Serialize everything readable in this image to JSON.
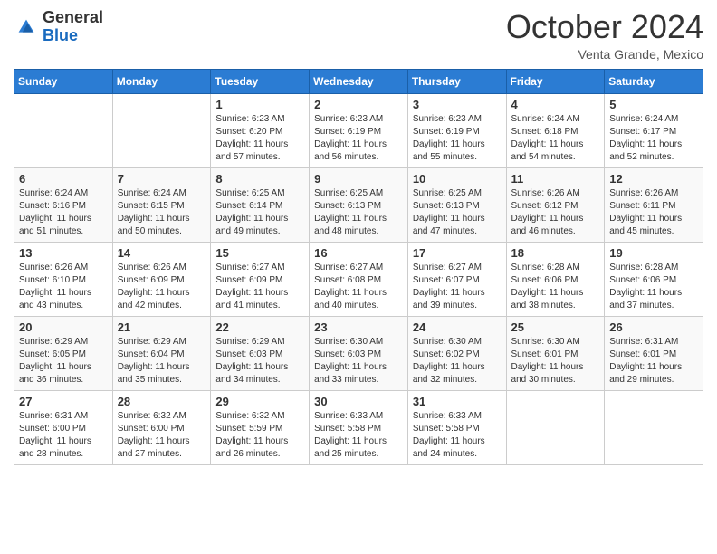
{
  "header": {
    "logo_general": "General",
    "logo_blue": "Blue",
    "month_title": "October 2024",
    "location": "Venta Grande, Mexico"
  },
  "days_of_week": [
    "Sunday",
    "Monday",
    "Tuesday",
    "Wednesday",
    "Thursday",
    "Friday",
    "Saturday"
  ],
  "weeks": [
    [
      {
        "day": "",
        "sunrise": "",
        "sunset": "",
        "daylight": ""
      },
      {
        "day": "",
        "sunrise": "",
        "sunset": "",
        "daylight": ""
      },
      {
        "day": "1",
        "sunrise": "Sunrise: 6:23 AM",
        "sunset": "Sunset: 6:20 PM",
        "daylight": "Daylight: 11 hours and 57 minutes."
      },
      {
        "day": "2",
        "sunrise": "Sunrise: 6:23 AM",
        "sunset": "Sunset: 6:19 PM",
        "daylight": "Daylight: 11 hours and 56 minutes."
      },
      {
        "day": "3",
        "sunrise": "Sunrise: 6:23 AM",
        "sunset": "Sunset: 6:19 PM",
        "daylight": "Daylight: 11 hours and 55 minutes."
      },
      {
        "day": "4",
        "sunrise": "Sunrise: 6:24 AM",
        "sunset": "Sunset: 6:18 PM",
        "daylight": "Daylight: 11 hours and 54 minutes."
      },
      {
        "day": "5",
        "sunrise": "Sunrise: 6:24 AM",
        "sunset": "Sunset: 6:17 PM",
        "daylight": "Daylight: 11 hours and 52 minutes."
      }
    ],
    [
      {
        "day": "6",
        "sunrise": "Sunrise: 6:24 AM",
        "sunset": "Sunset: 6:16 PM",
        "daylight": "Daylight: 11 hours and 51 minutes."
      },
      {
        "day": "7",
        "sunrise": "Sunrise: 6:24 AM",
        "sunset": "Sunset: 6:15 PM",
        "daylight": "Daylight: 11 hours and 50 minutes."
      },
      {
        "day": "8",
        "sunrise": "Sunrise: 6:25 AM",
        "sunset": "Sunset: 6:14 PM",
        "daylight": "Daylight: 11 hours and 49 minutes."
      },
      {
        "day": "9",
        "sunrise": "Sunrise: 6:25 AM",
        "sunset": "Sunset: 6:13 PM",
        "daylight": "Daylight: 11 hours and 48 minutes."
      },
      {
        "day": "10",
        "sunrise": "Sunrise: 6:25 AM",
        "sunset": "Sunset: 6:13 PM",
        "daylight": "Daylight: 11 hours and 47 minutes."
      },
      {
        "day": "11",
        "sunrise": "Sunrise: 6:26 AM",
        "sunset": "Sunset: 6:12 PM",
        "daylight": "Daylight: 11 hours and 46 minutes."
      },
      {
        "day": "12",
        "sunrise": "Sunrise: 6:26 AM",
        "sunset": "Sunset: 6:11 PM",
        "daylight": "Daylight: 11 hours and 45 minutes."
      }
    ],
    [
      {
        "day": "13",
        "sunrise": "Sunrise: 6:26 AM",
        "sunset": "Sunset: 6:10 PM",
        "daylight": "Daylight: 11 hours and 43 minutes."
      },
      {
        "day": "14",
        "sunrise": "Sunrise: 6:26 AM",
        "sunset": "Sunset: 6:09 PM",
        "daylight": "Daylight: 11 hours and 42 minutes."
      },
      {
        "day": "15",
        "sunrise": "Sunrise: 6:27 AM",
        "sunset": "Sunset: 6:09 PM",
        "daylight": "Daylight: 11 hours and 41 minutes."
      },
      {
        "day": "16",
        "sunrise": "Sunrise: 6:27 AM",
        "sunset": "Sunset: 6:08 PM",
        "daylight": "Daylight: 11 hours and 40 minutes."
      },
      {
        "day": "17",
        "sunrise": "Sunrise: 6:27 AM",
        "sunset": "Sunset: 6:07 PM",
        "daylight": "Daylight: 11 hours and 39 minutes."
      },
      {
        "day": "18",
        "sunrise": "Sunrise: 6:28 AM",
        "sunset": "Sunset: 6:06 PM",
        "daylight": "Daylight: 11 hours and 38 minutes."
      },
      {
        "day": "19",
        "sunrise": "Sunrise: 6:28 AM",
        "sunset": "Sunset: 6:06 PM",
        "daylight": "Daylight: 11 hours and 37 minutes."
      }
    ],
    [
      {
        "day": "20",
        "sunrise": "Sunrise: 6:29 AM",
        "sunset": "Sunset: 6:05 PM",
        "daylight": "Daylight: 11 hours and 36 minutes."
      },
      {
        "day": "21",
        "sunrise": "Sunrise: 6:29 AM",
        "sunset": "Sunset: 6:04 PM",
        "daylight": "Daylight: 11 hours and 35 minutes."
      },
      {
        "day": "22",
        "sunrise": "Sunrise: 6:29 AM",
        "sunset": "Sunset: 6:03 PM",
        "daylight": "Daylight: 11 hours and 34 minutes."
      },
      {
        "day": "23",
        "sunrise": "Sunrise: 6:30 AM",
        "sunset": "Sunset: 6:03 PM",
        "daylight": "Daylight: 11 hours and 33 minutes."
      },
      {
        "day": "24",
        "sunrise": "Sunrise: 6:30 AM",
        "sunset": "Sunset: 6:02 PM",
        "daylight": "Daylight: 11 hours and 32 minutes."
      },
      {
        "day": "25",
        "sunrise": "Sunrise: 6:30 AM",
        "sunset": "Sunset: 6:01 PM",
        "daylight": "Daylight: 11 hours and 30 minutes."
      },
      {
        "day": "26",
        "sunrise": "Sunrise: 6:31 AM",
        "sunset": "Sunset: 6:01 PM",
        "daylight": "Daylight: 11 hours and 29 minutes."
      }
    ],
    [
      {
        "day": "27",
        "sunrise": "Sunrise: 6:31 AM",
        "sunset": "Sunset: 6:00 PM",
        "daylight": "Daylight: 11 hours and 28 minutes."
      },
      {
        "day": "28",
        "sunrise": "Sunrise: 6:32 AM",
        "sunset": "Sunset: 6:00 PM",
        "daylight": "Daylight: 11 hours and 27 minutes."
      },
      {
        "day": "29",
        "sunrise": "Sunrise: 6:32 AM",
        "sunset": "Sunset: 5:59 PM",
        "daylight": "Daylight: 11 hours and 26 minutes."
      },
      {
        "day": "30",
        "sunrise": "Sunrise: 6:33 AM",
        "sunset": "Sunset: 5:58 PM",
        "daylight": "Daylight: 11 hours and 25 minutes."
      },
      {
        "day": "31",
        "sunrise": "Sunrise: 6:33 AM",
        "sunset": "Sunset: 5:58 PM",
        "daylight": "Daylight: 11 hours and 24 minutes."
      },
      {
        "day": "",
        "sunrise": "",
        "sunset": "",
        "daylight": ""
      },
      {
        "day": "",
        "sunrise": "",
        "sunset": "",
        "daylight": ""
      }
    ]
  ]
}
